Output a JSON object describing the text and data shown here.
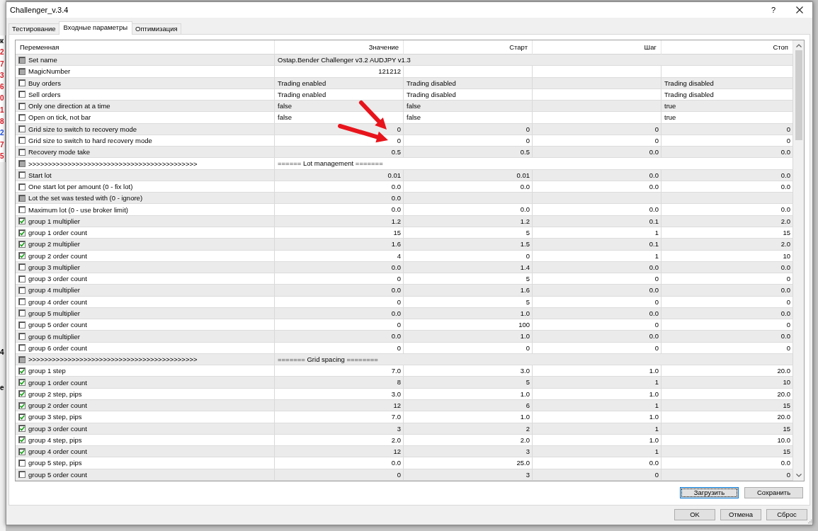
{
  "background_window": {
    "upper": [
      {
        "text": "к",
        "color": "#000000"
      },
      {
        "text": "2",
        "color": "#e0202a"
      },
      {
        "text": "7",
        "color": "#e0202a"
      },
      {
        "text": "3",
        "color": "#e0202a"
      },
      {
        "text": "6",
        "color": "#e0202a"
      },
      {
        "text": "0",
        "color": "#e0202a"
      },
      {
        "text": "1",
        "color": "#e0202a"
      },
      {
        "text": "8",
        "color": "#e0202a"
      },
      {
        "text": "2",
        "color": "#2050e0"
      },
      {
        "text": "7",
        "color": "#e0202a"
      },
      {
        "text": "5",
        "color": "#e0202a"
      }
    ],
    "lower": [
      {
        "text": "4",
        "color": "#000000"
      },
      {
        "text": "e",
        "color": "#000000"
      }
    ]
  },
  "window": {
    "title": "Challenger_v.3.4",
    "help": "?"
  },
  "tabs": [
    {
      "label": "Тестирование",
      "selected": false
    },
    {
      "label": "Входные параметры",
      "selected": true
    },
    {
      "label": "Оптимизация",
      "selected": false
    }
  ],
  "table": {
    "columns": [
      "Переменная",
      "Значение",
      "Старт",
      "Шаг",
      "Стоп"
    ],
    "rows": [
      {
        "name": "Set name",
        "checked": false,
        "disabled": true,
        "kind": "text",
        "value": "Ostap.Bender Challenger v3.2 AUDJPY v1.3"
      },
      {
        "name": "MagicNumber",
        "checked": false,
        "disabled": true,
        "kind": "number",
        "value": "121212"
      },
      {
        "name": "Buy orders",
        "checked": false,
        "disabled": false,
        "kind": "text",
        "value": "Trading enabled",
        "start": "Trading disabled",
        "stop": "Trading disabled"
      },
      {
        "name": "Sell orders",
        "checked": false,
        "disabled": false,
        "kind": "text",
        "value": "Trading enabled",
        "start": "Trading disabled",
        "stop": "Trading disabled"
      },
      {
        "name": "Only one direction at a time",
        "checked": false,
        "disabled": false,
        "kind": "text",
        "value": "false",
        "start": "false",
        "stop": "true"
      },
      {
        "name": "Open on tick, not bar",
        "checked": false,
        "disabled": false,
        "kind": "text",
        "value": "false",
        "start": "false",
        "stop": "true"
      },
      {
        "name": "Grid size to switch to recovery mode",
        "checked": false,
        "disabled": false,
        "kind": "number",
        "value": "0",
        "start": "0",
        "step": "0",
        "stop": "0"
      },
      {
        "name": "Grid size to switch to hard recovery mode",
        "checked": false,
        "disabled": false,
        "kind": "number",
        "value": "0",
        "start": "0",
        "step": "0",
        "stop": "0"
      },
      {
        "name": "Recovery mode take",
        "checked": false,
        "disabled": false,
        "kind": "number",
        "value": "0.5",
        "start": "0.5",
        "step": "0.0",
        "stop": "0.0"
      },
      {
        "name": ">>>>>>>>>>>>>>>>>>>>>>>>>>>>>>>>>>>>>>>>>>>",
        "checked": false,
        "disabled": true,
        "kind": "text",
        "value": "====== Lot management ======="
      },
      {
        "name": "Start lot",
        "checked": false,
        "disabled": false,
        "kind": "number",
        "value": "0.01",
        "start": "0.01",
        "step": "0.0",
        "stop": "0.0"
      },
      {
        "name": "One start lot per amount (0 - fix lot)",
        "checked": false,
        "disabled": false,
        "kind": "number",
        "value": "0.0",
        "start": "0.0",
        "step": "0.0",
        "stop": "0.0"
      },
      {
        "name": "Lot the set was tested with (0 - ignore)",
        "checked": false,
        "disabled": true,
        "kind": "number",
        "value": "0.0"
      },
      {
        "name": "Maximum lot (0 - use broker limit)",
        "checked": false,
        "disabled": false,
        "kind": "number",
        "value": "0.0",
        "start": "0.0",
        "step": "0.0",
        "stop": "0.0"
      },
      {
        "name": "group 1 multiplier",
        "checked": true,
        "disabled": false,
        "kind": "number",
        "value": "1.2",
        "start": "1.2",
        "step": "0.1",
        "stop": "2.0"
      },
      {
        "name": "group 1 order count",
        "checked": true,
        "disabled": false,
        "kind": "number",
        "value": "15",
        "start": "5",
        "step": "1",
        "stop": "15"
      },
      {
        "name": "group 2 multiplier",
        "checked": true,
        "disabled": false,
        "kind": "number",
        "value": "1.6",
        "start": "1.5",
        "step": "0.1",
        "stop": "2.0"
      },
      {
        "name": "group 2 order count",
        "checked": true,
        "disabled": false,
        "kind": "number",
        "value": "4",
        "start": "0",
        "step": "1",
        "stop": "10"
      },
      {
        "name": "group 3 multiplier",
        "checked": false,
        "disabled": false,
        "kind": "number",
        "value": "0.0",
        "start": "1.4",
        "step": "0.0",
        "stop": "0.0"
      },
      {
        "name": "group 3 order count",
        "checked": false,
        "disabled": false,
        "kind": "number",
        "value": "0",
        "start": "5",
        "step": "0",
        "stop": "0"
      },
      {
        "name": "group 4 multiplier",
        "checked": false,
        "disabled": false,
        "kind": "number",
        "value": "0.0",
        "start": "1.6",
        "step": "0.0",
        "stop": "0.0"
      },
      {
        "name": "group 4 order count",
        "checked": false,
        "disabled": false,
        "kind": "number",
        "value": "0",
        "start": "5",
        "step": "0",
        "stop": "0"
      },
      {
        "name": "group 5 multiplier",
        "checked": false,
        "disabled": false,
        "kind": "number",
        "value": "0.0",
        "start": "1.0",
        "step": "0.0",
        "stop": "0.0"
      },
      {
        "name": "group 5 order count",
        "checked": false,
        "disabled": false,
        "kind": "number",
        "value": "0",
        "start": "100",
        "step": "0",
        "stop": "0"
      },
      {
        "name": "group 6 multiplier",
        "checked": false,
        "disabled": false,
        "kind": "number",
        "value": "0.0",
        "start": "1.0",
        "step": "0.0",
        "stop": "0.0"
      },
      {
        "name": "group 6 order count",
        "checked": false,
        "disabled": false,
        "kind": "number",
        "value": "0",
        "start": "0",
        "step": "0",
        "stop": "0"
      },
      {
        "name": ">>>>>>>>>>>>>>>>>>>>>>>>>>>>>>>>>>>>>>>>>>>",
        "checked": false,
        "disabled": true,
        "kind": "text",
        "value": "======= Grid spacing ========"
      },
      {
        "name": "group 1 step",
        "checked": true,
        "disabled": false,
        "kind": "number",
        "value": "7.0",
        "start": "3.0",
        "step": "1.0",
        "stop": "20.0"
      },
      {
        "name": "group 1 order count",
        "checked": true,
        "disabled": false,
        "kind": "number",
        "value": "8",
        "start": "5",
        "step": "1",
        "stop": "10"
      },
      {
        "name": "group 2 step, pips",
        "checked": true,
        "disabled": false,
        "kind": "number",
        "value": "3.0",
        "start": "1.0",
        "step": "1.0",
        "stop": "20.0"
      },
      {
        "name": "group 2 order count",
        "checked": true,
        "disabled": false,
        "kind": "number",
        "value": "12",
        "start": "6",
        "step": "1",
        "stop": "15"
      },
      {
        "name": "group 3 step, pips",
        "checked": true,
        "disabled": false,
        "kind": "number",
        "value": "7.0",
        "start": "1.0",
        "step": "1.0",
        "stop": "20.0"
      },
      {
        "name": "group 3 order count",
        "checked": true,
        "disabled": false,
        "kind": "number",
        "value": "3",
        "start": "2",
        "step": "1",
        "stop": "15"
      },
      {
        "name": "group 4 step, pips",
        "checked": true,
        "disabled": false,
        "kind": "number",
        "value": "2.0",
        "start": "2.0",
        "step": "1.0",
        "stop": "10.0"
      },
      {
        "name": "group 4 order count",
        "checked": true,
        "disabled": false,
        "kind": "number",
        "value": "12",
        "start": "3",
        "step": "1",
        "stop": "15"
      },
      {
        "name": "group 5 step, pips",
        "checked": false,
        "disabled": false,
        "kind": "number",
        "value": "0.0",
        "start": "25.0",
        "step": "0.0",
        "stop": "0.0"
      },
      {
        "name": "group 5 order count",
        "checked": false,
        "disabled": false,
        "kind": "number",
        "value": "0",
        "start": "3",
        "step": "0",
        "stop": "0"
      }
    ]
  },
  "panel_buttons": [
    {
      "label": "Загрузить",
      "focused": true
    },
    {
      "label": "Сохранить",
      "focused": false
    }
  ],
  "dialog_buttons": [
    {
      "label": "OK",
      "focused": false
    },
    {
      "label": "Отмена",
      "focused": false
    },
    {
      "label": "Сброс",
      "focused": false
    }
  ],
  "annotation_arrows": [
    {
      "kind": "arrow"
    },
    {
      "kind": "arrow"
    }
  ]
}
